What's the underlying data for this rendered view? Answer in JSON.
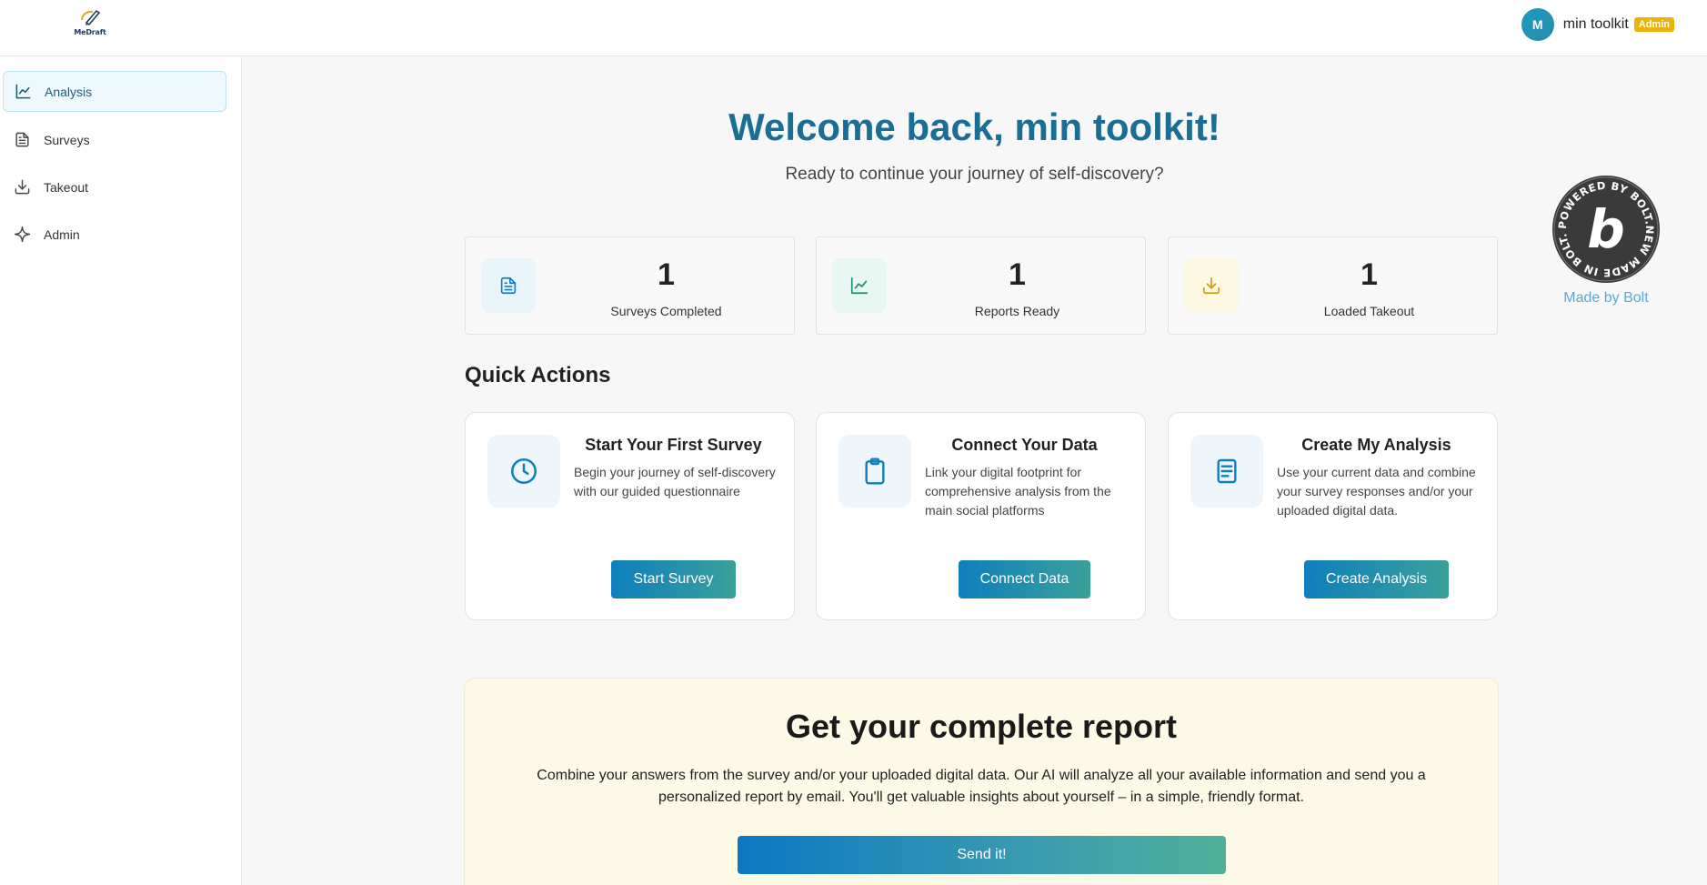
{
  "header": {
    "logo_text": "MeDraft",
    "user": {
      "avatar_initial": "M",
      "name": "min toolkit",
      "role_badge": "Admin"
    }
  },
  "sidebar": {
    "items": [
      {
        "label": "Analysis",
        "icon": "chart-line-icon",
        "active": true
      },
      {
        "label": "Surveys",
        "icon": "document-icon",
        "active": false
      },
      {
        "label": "Takeout",
        "icon": "download-icon",
        "active": false
      },
      {
        "label": "Admin",
        "icon": "sparkle-icon",
        "active": false
      }
    ]
  },
  "main": {
    "welcome_title": "Welcome back, min toolkit!",
    "welcome_subtitle": "Ready to continue your journey of self-discovery?",
    "stats": [
      {
        "value": "1",
        "label": "Surveys Completed",
        "icon": "document-icon",
        "icon_color": "#0e7fbd",
        "icon_bg": "#eaf4fb"
      },
      {
        "value": "1",
        "label": "Reports Ready",
        "icon": "chart-line-icon",
        "icon_color": "#1a8f7a",
        "icon_bg": "#e8f7f1"
      },
      {
        "value": "1",
        "label": "Loaded Takeout",
        "icon": "download-icon",
        "icon_color": "#d39a0c",
        "icon_bg": "#fdf8e2"
      }
    ],
    "quick_actions_title": "Quick Actions",
    "quick_actions": [
      {
        "title": "Start Your First Survey",
        "description": "Begin your journey of self-discovery with our guided questionnaire",
        "button": "Start Survey",
        "icon": "clock-icon"
      },
      {
        "title": "Connect Your Data",
        "description": "Link your digital footprint for comprehensive analysis from the main social platforms",
        "button": "Connect Data",
        "icon": "clipboard-icon"
      },
      {
        "title": "Create My Analysis",
        "description": "Use your current data and combine your survey responses and/or your uploaded digital data.",
        "button": "Create Analysis",
        "icon": "notes-icon"
      }
    ],
    "report": {
      "title": "Get your complete report",
      "text": "Combine your answers from the survey and/or your uploaded digital data. Our AI will analyze all your available information and send you a personalized report by email. You'll get valuable insights about yourself – in a simple, friendly format.",
      "button": "Send it!"
    }
  },
  "bolt": {
    "ring_text": "POWERED BY BOLT.NEW MADE IN BOLT.NEW",
    "letter": "b",
    "caption": "Made by Bolt"
  },
  "colors": {
    "accent": "#1a6e95",
    "button_gradient_start": "#0e7fbd",
    "button_gradient_end": "#3aa09a",
    "admin_badge": "#eab308"
  }
}
